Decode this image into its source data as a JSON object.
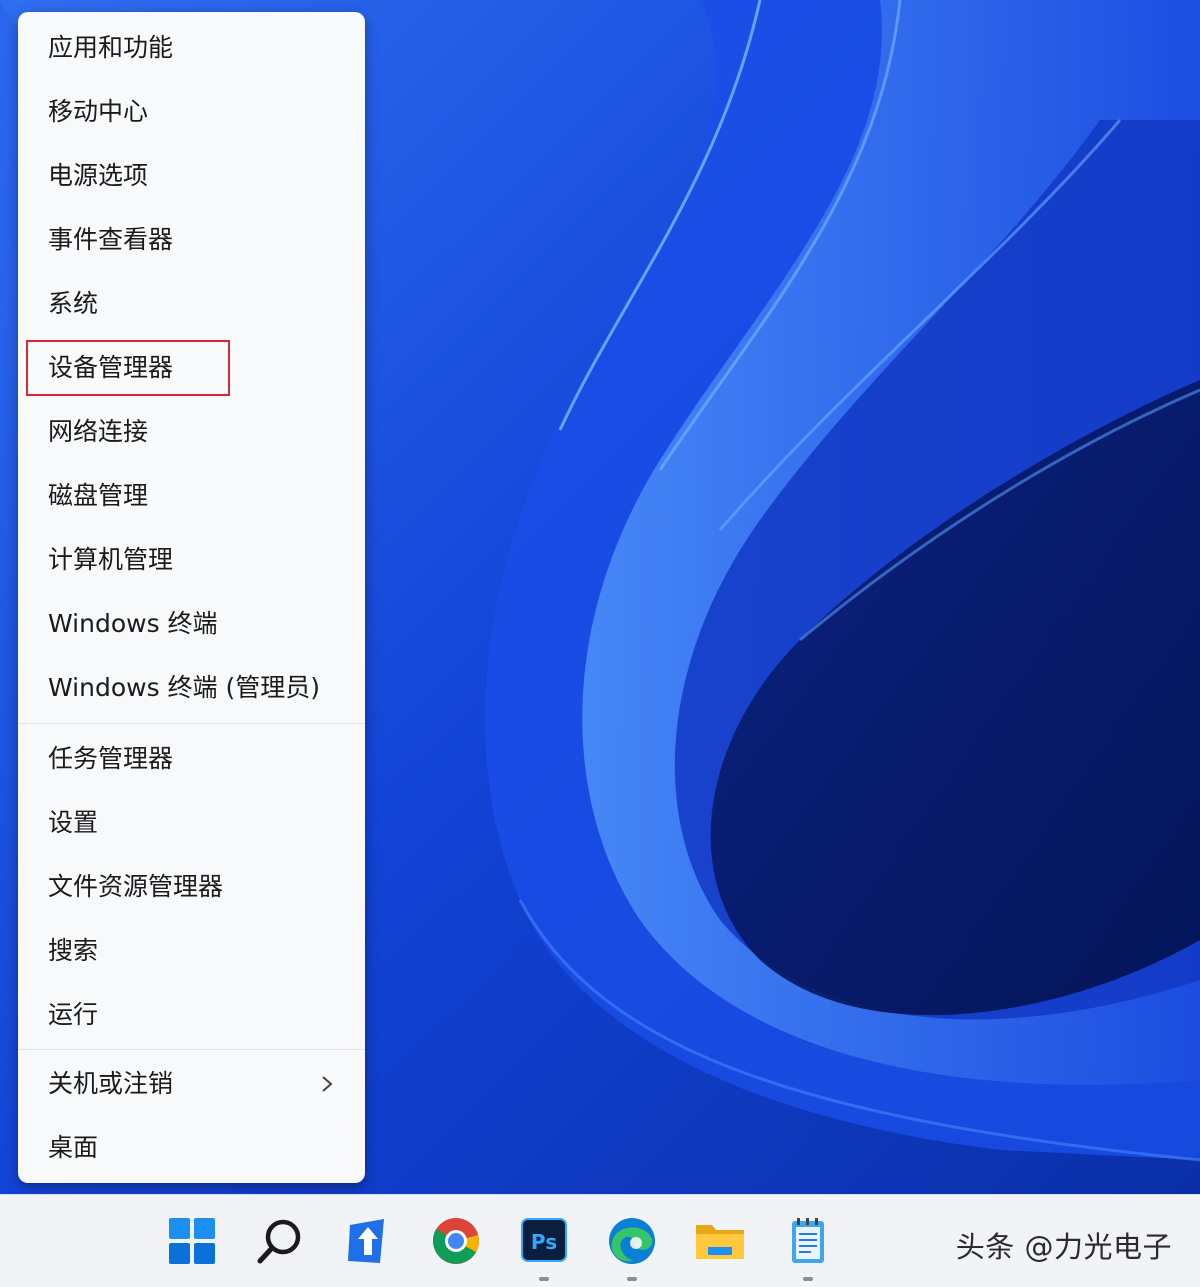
{
  "menu": {
    "items": [
      {
        "label": "应用和功能"
      },
      {
        "label": "移动中心"
      },
      {
        "label": "电源选项"
      },
      {
        "label": "事件查看器"
      },
      {
        "label": "系统"
      },
      {
        "label": "设备管理器"
      },
      {
        "label": "网络连接"
      },
      {
        "label": "磁盘管理"
      },
      {
        "label": "计算机管理"
      },
      {
        "label": "Windows 终端"
      },
      {
        "label": "Windows 终端 (管理员)"
      },
      {
        "label": "任务管理器"
      },
      {
        "label": "设置"
      },
      {
        "label": "文件资源管理器"
      },
      {
        "label": "搜索"
      },
      {
        "label": "运行"
      },
      {
        "label": "关机或注销"
      },
      {
        "label": "桌面"
      }
    ],
    "highlighted_item": "设备管理器",
    "highlight_color": "#d0283c"
  },
  "taskbar": {
    "icons": [
      "windows-start-icon",
      "search-icon",
      "arrow-app-icon",
      "chrome-icon",
      "photoshop-icon",
      "edge-icon",
      "file-explorer-icon",
      "notepad-icon"
    ],
    "photoshop_label": "Ps",
    "accent": "#0067c0"
  },
  "watermark": "头条 @力光电子"
}
